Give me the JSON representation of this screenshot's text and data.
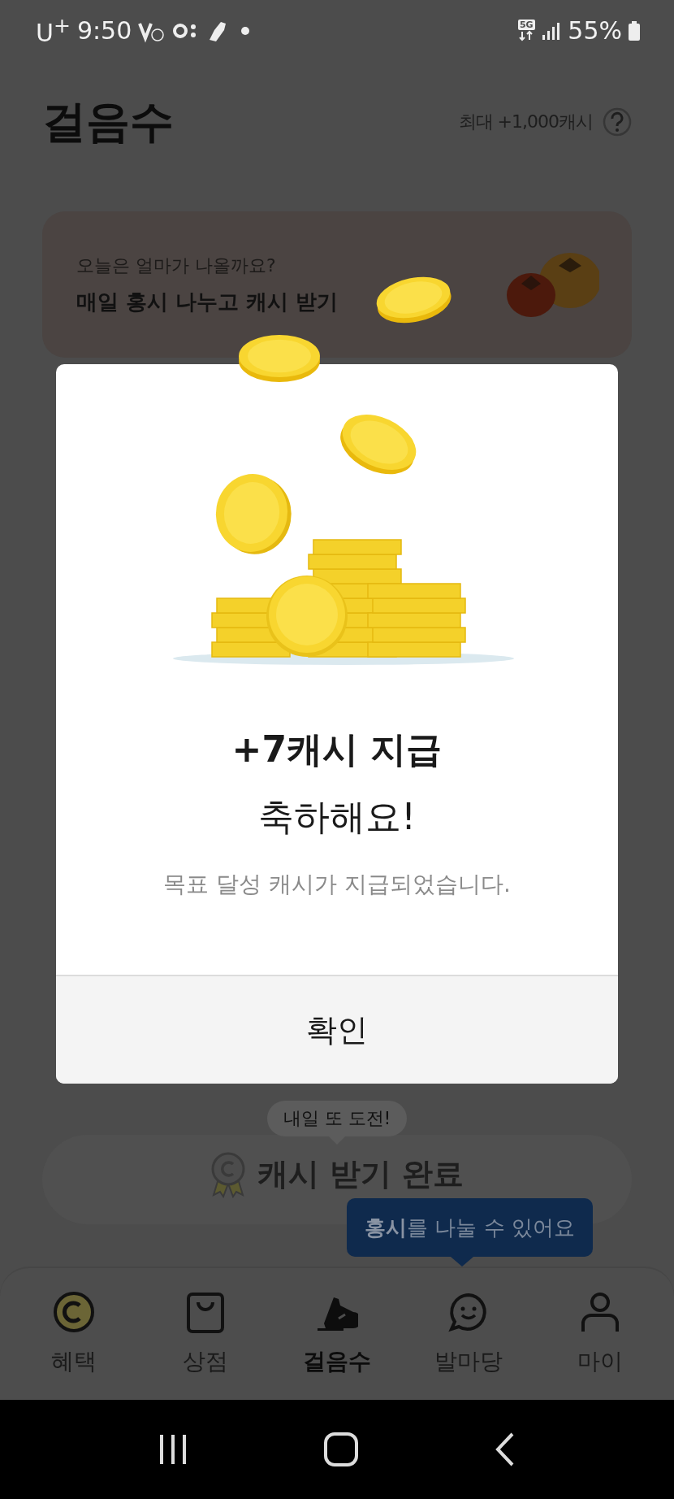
{
  "status_bar": {
    "carrier": "U$^{+}$",
    "time": "9:50",
    "network": "5G",
    "battery": "55%"
  },
  "header": {
    "title": "걸음수",
    "max_reward": "최대 +1,000캐시"
  },
  "banner": {
    "subtitle": "오늘은 얼마가 나올까요?",
    "title": "매일 홍시 나누고 캐시 받기"
  },
  "dialog": {
    "title": "+7캐시 지급",
    "heading": "축하해요!",
    "message": "목표 달성 캐시가 지급되었습니다.",
    "button": "확인"
  },
  "challenge_tooltip": "내일 또 도전!",
  "cash_button": {
    "label": "캐시 받기 완료"
  },
  "share_tooltip": "**홍시**를 나눌 수 있어요",
  "nav": [
    {
      "label": "혜택",
      "selected": false
    },
    {
      "label": "상점",
      "selected": false
    },
    {
      "label": "걸음수",
      "selected": true
    },
    {
      "label": "발마당",
      "selected": false
    },
    {
      "label": "마이",
      "selected": false
    }
  ]
}
